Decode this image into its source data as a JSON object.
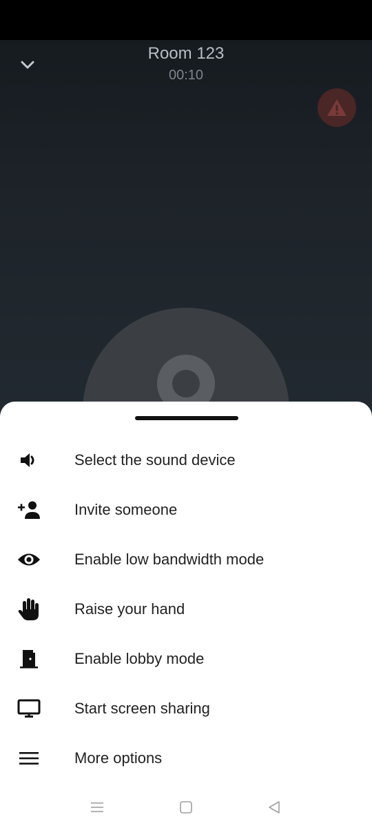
{
  "call": {
    "room_title": "Room 123",
    "timer": "00:10"
  },
  "icons": {
    "collapse": "chevron-down-icon",
    "warning": "warning-icon",
    "speaker": "speaker-icon",
    "invite": "person-add-icon",
    "eye": "eye-icon",
    "hand": "hand-icon",
    "door": "door-icon",
    "monitor": "monitor-icon",
    "menu": "hamburger-icon"
  },
  "colors": {
    "warning_bg": "#4a2626",
    "warning_fg": "#7a3a3a",
    "sheet_bg": "#ffffff",
    "text": "#222222"
  },
  "menu": {
    "items": [
      {
        "label": "Select the sound device",
        "icon": "speaker-icon"
      },
      {
        "label": "Invite someone",
        "icon": "person-add-icon"
      },
      {
        "label": "Enable low bandwidth mode",
        "icon": "eye-icon"
      },
      {
        "label": "Raise your hand",
        "icon": "hand-icon"
      },
      {
        "label": "Enable lobby mode",
        "icon": "door-icon"
      },
      {
        "label": "Start screen sharing",
        "icon": "monitor-icon"
      },
      {
        "label": "More options",
        "icon": "hamburger-icon"
      }
    ]
  },
  "nav": {
    "recents": "recents-icon",
    "home": "home-icon",
    "back": "back-icon"
  }
}
